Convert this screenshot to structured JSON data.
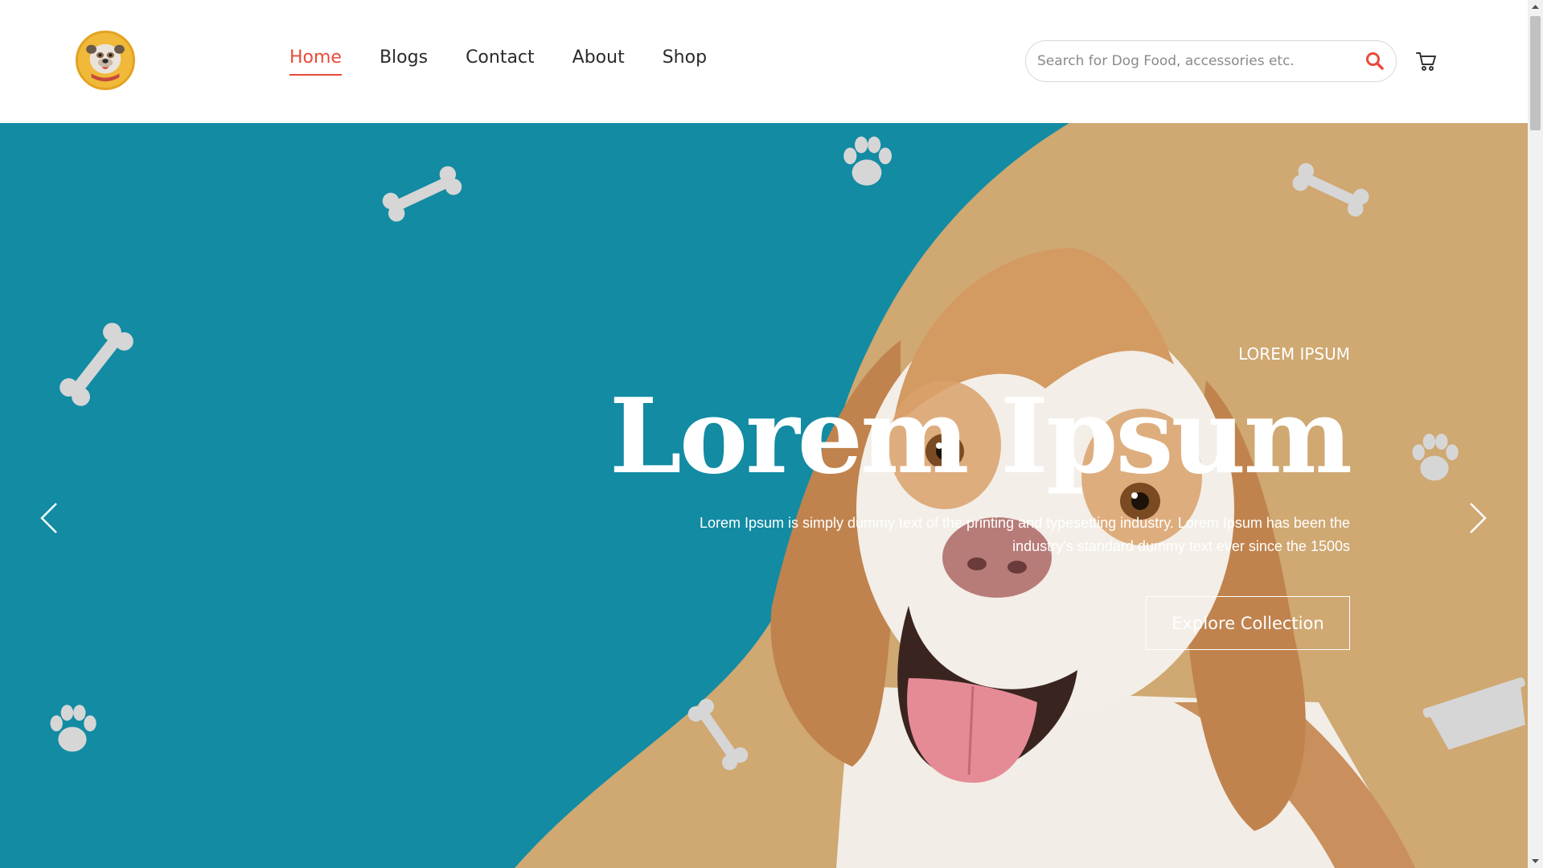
{
  "header": {
    "logo_icon": "bulldog-logo",
    "nav": [
      {
        "label": "Home",
        "active": true
      },
      {
        "label": "Blogs",
        "active": false
      },
      {
        "label": "Contact",
        "active": false
      },
      {
        "label": "About",
        "active": false
      },
      {
        "label": "Shop",
        "active": false
      }
    ],
    "search": {
      "placeholder": "Search for Dog Food, accessories etc.",
      "value": "",
      "icon": "search-icon"
    },
    "cart_icon": "cart-icon"
  },
  "hero": {
    "eyebrow": "LOREM IPSUM",
    "headline": "Lorem Ipsum",
    "description": "Lorem Ipsum is simply dummy text of the printing and typesetting industry. Lorem Ipsum has been the industry’s standard dummy text ever since the 1500s",
    "cta_label": "Explore Collection",
    "prev_icon": "chevron-left-icon",
    "next_icon": "chevron-right-icon",
    "image_subject": "beagle-dog"
  },
  "colors": {
    "accent": "#e84a3b",
    "hero_teal": "#128ba3",
    "hero_tan": "#cfa872",
    "text_dark": "#2b2b2b"
  }
}
